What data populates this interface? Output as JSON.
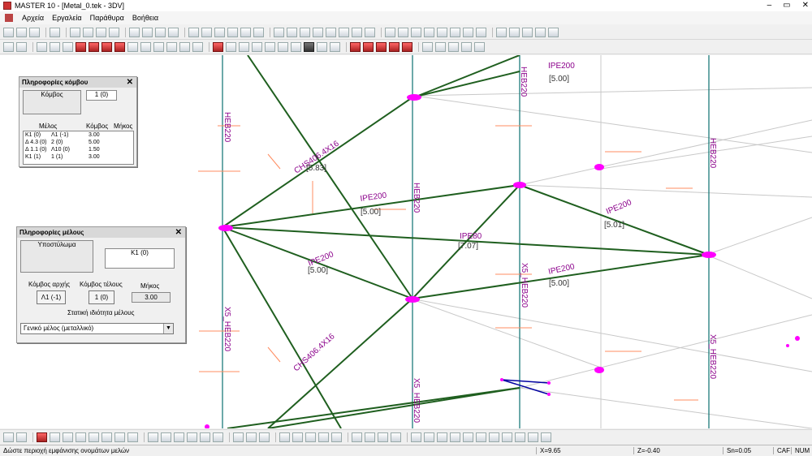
{
  "window": {
    "title": "MASTER 10 - [Metal_0.tek - 3DV]",
    "controls": [
      "–",
      "▭",
      "✕"
    ]
  },
  "menu": {
    "items": [
      "Αρχεία",
      "Εργαλεία",
      "Παράθυρα",
      "Βοήθεια"
    ],
    "mdi_controls": [
      "–",
      "▭",
      "✕"
    ]
  },
  "node_panel": {
    "title": "Πληροφορίες κόμβου",
    "node_label": "Κόμβος",
    "node_value": "1 (0)",
    "columns": [
      "Μέλος",
      "Κόμβος",
      "Μήκος"
    ],
    "rows": [
      [
        "K1 (0)",
        "Λ1 (-1)",
        "3.00"
      ],
      [
        "Δ 4.3 (0)",
        "2 (0)",
        "5.00"
      ],
      [
        "Δ 1.1 (0)",
        "Λ10 (0)",
        "1.50"
      ],
      [
        "K1 (1)",
        "1 (1)",
        "3.00"
      ]
    ]
  },
  "member_panel": {
    "title": "Πληροφορίες μέλους",
    "type_label": "Υποστύλωμα",
    "member_name": "K1 (0)",
    "start_node_label": "Κόμβος αρχής",
    "end_node_label": "Κόμβος τέλους",
    "length_label": "Μήκος",
    "start_node": "Λ1 (-1)",
    "end_node": "1 (0)",
    "length": "3.00",
    "property_label": "Στατική ιδιότητα μέλους",
    "property_value": "Γενικό μέλος (μεταλλικό)"
  },
  "model_labels": {
    "ipe200_top": "IPE200",
    "ipe200_top_len": "[5.00]",
    "heb220_top": "HEB220",
    "heb220_left": "HEB220",
    "chs_top": "CHS406.4X16",
    "chs_top_len": "[5.83]",
    "ipe200_mid": "IPE200",
    "ipe200_mid_len": "[5.00]",
    "heb220_mid": "HEB220",
    "heb220_right": "HEB220",
    "ipe200_right": "IPE200",
    "ipe200_right_len": "[5.01]",
    "ipe80": "IPE80",
    "ipe80_len": "[7.07]",
    "ipe200_left": "IPE200",
    "ipe200_left_len": "[5.00]",
    "ipe200_low": "IPE200",
    "ipe200_low_len": "[5.00]",
    "x5_heb220_center": "X5_HEB220",
    "x5_heb220_left": "X5_HEB220",
    "chs_low": "CHS406.4X16",
    "x5_heb220_bottom": "X5_HEB220",
    "x5_heb220_right": "X5_HEB220"
  },
  "status": {
    "hint": "Δώστε περιοχή εμφάνισης ονομάτων μελών",
    "x": "X=9.65",
    "z": "Z=-0.40",
    "sn": "Sn=0.05",
    "caf": "CAF",
    "num": "NUM"
  },
  "colors": {
    "member": "#1f5f1f",
    "column": "#0a7070",
    "label": "#8b008b",
    "node": "#ff00ff",
    "axis": "#ff8c60",
    "grid": "#c8c8c8"
  }
}
